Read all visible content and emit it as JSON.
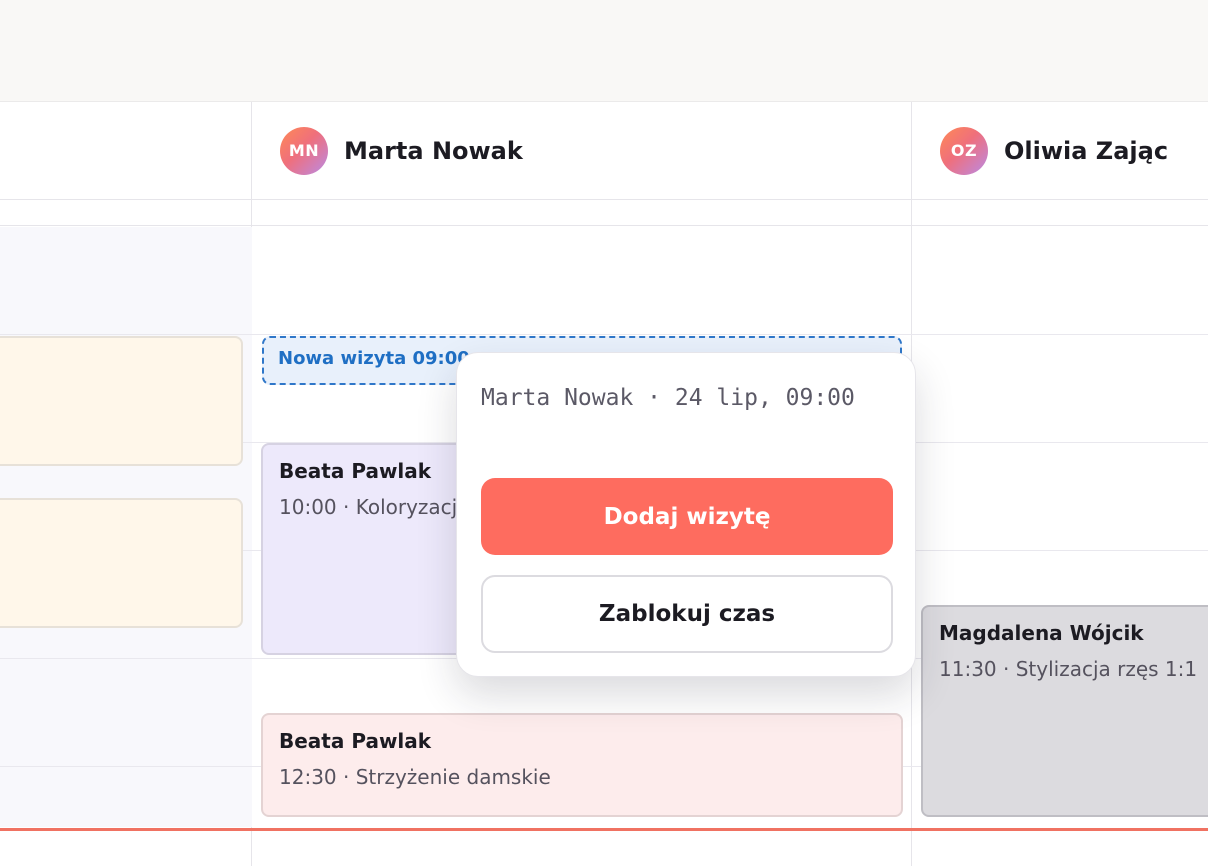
{
  "columns": [
    {
      "initials": "MN",
      "name": "Marta Nowak"
    },
    {
      "initials": "OZ",
      "name": "Oliwia Zając"
    }
  ],
  "appointments": [
    {
      "name": "Beata Pawlak",
      "detail": "10:00 · Koloryzacja"
    },
    {
      "name": "Beata Pawlak",
      "detail": "12:30 · Strzyżenie damskie"
    },
    {
      "name": "Magdalena Wójcik",
      "detail": "11:30 · Stylizacja rzęs 1:1"
    }
  ],
  "new_slot": {
    "label": "Nowa wizyta 09:00"
  },
  "popover": {
    "title": "Marta Nowak · 24 lip, 09:00",
    "primary_button": "Dodaj wizytę",
    "secondary_button": "Zablokuj czas"
  },
  "colors": {
    "accent": "#fe6c5f",
    "now_line": "#f07262",
    "selection": "#2f77c9"
  }
}
